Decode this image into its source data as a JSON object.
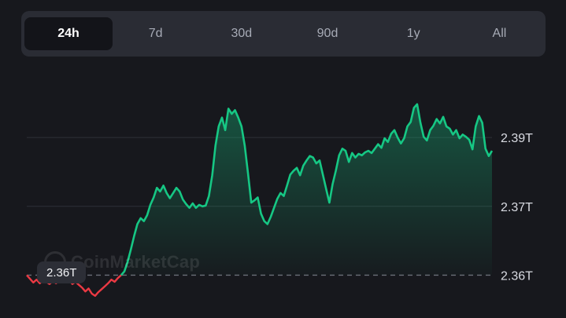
{
  "tabs": [
    {
      "label": "24h",
      "active": true
    },
    {
      "label": "7d",
      "active": false
    },
    {
      "label": "30d",
      "active": false
    },
    {
      "label": "90d",
      "active": false
    },
    {
      "label": "1y",
      "active": false
    },
    {
      "label": "All",
      "active": false
    }
  ],
  "watermark": "CoinMarketCap",
  "colors": {
    "up": "#16c784",
    "down": "#ea3943",
    "background": "#17181d"
  },
  "chart_data": {
    "type": "area",
    "baseline_value": 2.3607,
    "baseline_label": "2.36T",
    "y_ticks": [
      {
        "value": 2.3607,
        "label": "2.36T"
      },
      {
        "value": 2.37,
        "label": "2.37T"
      },
      {
        "value": 2.3793,
        "label": "2.39T"
      }
    ],
    "ylim": [
      2.3565,
      2.386
    ],
    "grid": true,
    "values": [
      2.3607,
      2.3602,
      2.3597,
      2.3601,
      2.3596,
      2.36,
      2.3598,
      2.3595,
      2.3599,
      2.3596,
      2.36,
      2.3603,
      2.3598,
      2.3601,
      2.3595,
      2.3598,
      2.3594,
      2.359,
      2.3585,
      2.3589,
      2.3582,
      2.3579,
      2.3584,
      2.3588,
      2.3592,
      2.3596,
      2.3601,
      2.3598,
      2.3603,
      2.3607,
      2.3612,
      2.3625,
      2.3642,
      2.366,
      2.3676,
      2.3684,
      2.368,
      2.3688,
      2.3702,
      2.3712,
      2.3725,
      2.372,
      2.3728,
      2.3718,
      2.3711,
      2.3718,
      2.3725,
      2.372,
      2.3709,
      2.3703,
      2.3698,
      2.3704,
      2.3698,
      2.3702,
      2.37,
      2.3701,
      2.3714,
      2.3742,
      2.3782,
      2.3808,
      2.382,
      2.3803,
      2.3832,
      2.3825,
      2.383,
      2.382,
      2.3808,
      2.3782,
      2.3745,
      2.3705,
      2.3708,
      2.3712,
      2.369,
      2.368,
      2.3676,
      2.3686,
      2.3698,
      2.371,
      2.3718,
      2.3714,
      2.3728,
      2.3743,
      2.3748,
      2.3752,
      2.3742,
      2.3755,
      2.3762,
      2.3768,
      2.3766,
      2.3758,
      2.3762,
      2.3743,
      2.3724,
      2.3705,
      2.373,
      2.3748,
      2.3769,
      2.3778,
      2.3775,
      2.376,
      2.3772,
      2.3766,
      2.3771,
      2.3769,
      2.3773,
      2.3775,
      2.3772,
      2.3778,
      2.3784,
      2.3779,
      2.3792,
      2.3787,
      2.3798,
      2.3803,
      2.3793,
      2.3785,
      2.3792,
      2.3808,
      2.3814,
      2.3833,
      2.3838,
      2.3813,
      2.3794,
      2.3789,
      2.3803,
      2.3809,
      2.3818,
      2.3812,
      2.3821,
      2.3808,
      2.3805,
      2.3797,
      2.3803,
      2.3792,
      2.3797,
      2.3794,
      2.379,
      2.3777,
      2.3808,
      2.3822,
      2.3813,
      2.3778,
      2.3768,
      2.3775
    ]
  }
}
